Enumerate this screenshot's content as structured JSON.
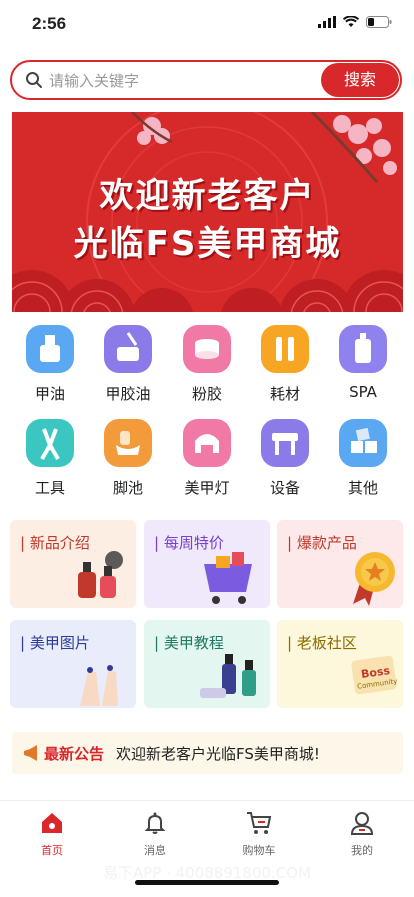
{
  "status_bar": {
    "time": "2:56"
  },
  "search": {
    "placeholder": "请输入关键字",
    "button": "搜索"
  },
  "banner": {
    "line1": "欢迎新老客户",
    "line2": "光临FS美甲商城"
  },
  "categories": [
    {
      "label": "甲油",
      "icon": "nail-polish-icon",
      "color": "#5aa7f2"
    },
    {
      "label": "甲胶油",
      "icon": "gel-polish-icon",
      "color": "#8b7be8"
    },
    {
      "label": "粉胶",
      "icon": "powder-jar-icon",
      "color": "#f07aa5"
    },
    {
      "label": "耗材",
      "icon": "supplies-icon",
      "color": "#f6a623"
    },
    {
      "label": "SPA",
      "icon": "spa-bottle-icon",
      "color": "#8f82ef"
    },
    {
      "label": "工具",
      "icon": "nipper-tool-icon",
      "color": "#3cc6c2"
    },
    {
      "label": "脚池",
      "icon": "foot-spa-icon",
      "color": "#f39a3a"
    },
    {
      "label": "美甲灯",
      "icon": "nail-lamp-icon",
      "color": "#f07aa5"
    },
    {
      "label": "设备",
      "icon": "equipment-icon",
      "color": "#8b7be8"
    },
    {
      "label": "其他",
      "icon": "others-icon",
      "color": "#5aa7f2"
    }
  ],
  "promo_cards": [
    {
      "title": "新品介绍",
      "title_color": "#c0392b",
      "bg": "#fdeee4"
    },
    {
      "title": "每周特价",
      "title_color": "#7b3fd0",
      "bg": "#f0e8fb"
    },
    {
      "title": "爆款产品",
      "title_color": "#c0392b",
      "bg": "#fde9ea"
    },
    {
      "title": "美甲图片",
      "title_color": "#2d3a9a",
      "bg": "#e9edfb"
    },
    {
      "title": "美甲教程",
      "title_color": "#1e7a63",
      "bg": "#e3f6ef"
    },
    {
      "title": "老板社区",
      "title_color": "#8a6d00",
      "bg": "#fdf7dc"
    }
  ],
  "promo_art": {
    "boss_badge": "Boss",
    "community": "Community"
  },
  "notice": {
    "label": "最新公告",
    "message": "欢迎新老客户光临FS美甲商城!"
  },
  "tabs": [
    {
      "label": "首页",
      "icon": "home-icon",
      "active": true
    },
    {
      "label": "消息",
      "icon": "bell-icon",
      "active": false
    },
    {
      "label": "购物车",
      "icon": "cart-icon",
      "active": false
    },
    {
      "label": "我的",
      "icon": "user-icon",
      "active": false
    }
  ],
  "footer_text": "易下APP · 4008891800.COM",
  "colors": {
    "accent": "#d9282c",
    "banner_bg": "#d62a2a"
  }
}
